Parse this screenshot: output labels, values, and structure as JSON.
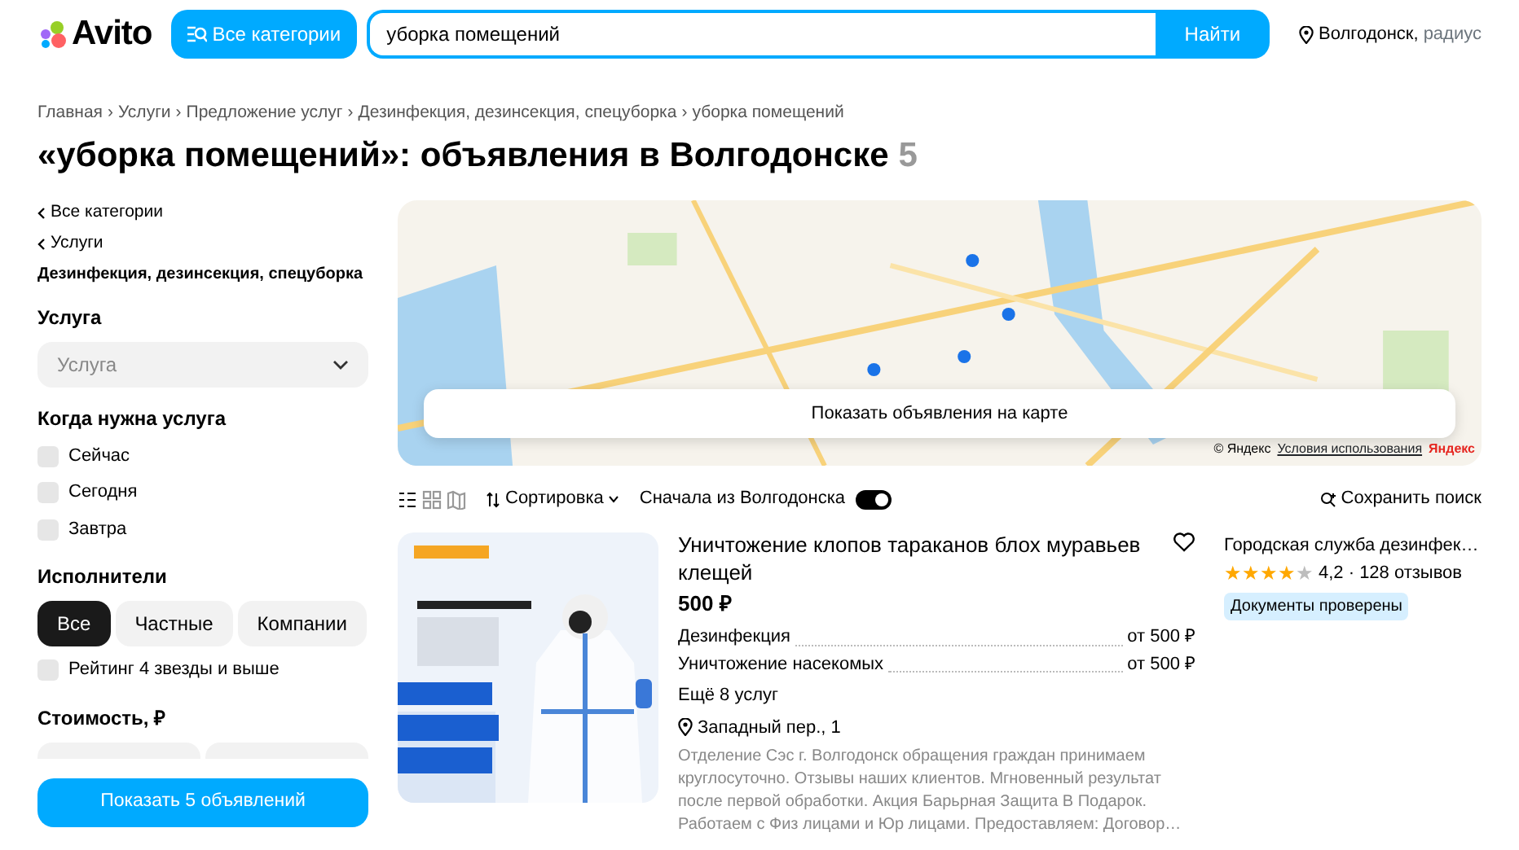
{
  "header": {
    "logo": "Avito",
    "categories_button": "Все категории",
    "search": {
      "value": "уборка помещений"
    },
    "search_button": "Найти",
    "location": "Волгодонск,",
    "radius": "радиус"
  },
  "breadcrumb_separator": "›",
  "breadcrumbs": [
    "Главная",
    "Услуги",
    "Предложение услуг",
    "Дезинфекция, дезинсекция, спецуборка",
    "уборка помещений"
  ],
  "page_title": "«уборка помещений»: объявления в Волгодонске",
  "result_count": "5",
  "sidebar": {
    "back_links": [
      "Все категории",
      "Услуги"
    ],
    "current_category": "Дезинфекция, дезинсекция, спецуборка",
    "service": {
      "title": "Услуга",
      "placeholder": "Услуга"
    },
    "when": {
      "title": "Когда нужна услуга",
      "options": [
        {
          "label": "Сейчас",
          "checked": false
        },
        {
          "label": "Сегодня",
          "checked": false
        },
        {
          "label": "Завтра",
          "checked": false
        }
      ]
    },
    "performers": {
      "title": "Исполнители",
      "segments": [
        {
          "label": "Все",
          "selected": true
        },
        {
          "label": "Частные",
          "selected": false
        },
        {
          "label": "Компании",
          "selected": false
        }
      ]
    },
    "rating_filter": {
      "label": "Рейтинг 4 звезды и выше",
      "checked": false
    },
    "price": {
      "title": "Стоимость, ₽"
    },
    "show_button": "Показать 5 объявлений"
  },
  "map": {
    "kind": "picture",
    "button": "Показать объявления на карте",
    "copyright": "© Яндекс",
    "terms_link": "Условия использования",
    "brand": "Яндекс"
  },
  "toolbar": {
    "views": [
      {
        "kind": "list",
        "selected": true
      },
      {
        "kind": "grid",
        "selected": false
      },
      {
        "kind": "map",
        "selected": false
      }
    ],
    "sort": "Сортировка",
    "toggle": {
      "label": "Сначала из Волгодонска",
      "on": true
    },
    "save_search": "Сохранить поиск"
  },
  "listings": [
    {
      "image": {
        "kind": "picture"
      },
      "title": "Уничтожение клопов тараканов блох муравьев клещей",
      "price": "500 ₽",
      "favorite": false,
      "services": [
        {
          "name": "Дезинфекция",
          "price": "от 500 ₽"
        },
        {
          "name": "Уничтожение насекомых",
          "price": "от 500 ₽"
        }
      ],
      "more": "Ещё 8 услуг",
      "address": "Западный пер., 1",
      "description": "Отделение Сэс г. Волгодонск обращения граждан принимаем круглосуточно. Отзывы наших клиентов. Мгновенный результат после первой обработки. Акция Барьрная Защита В Подарок. Работаем с Физ лицами и Юр лицами. Предоставляем: Договор…",
      "seller": {
        "name": "Городская служба дезинфек…",
        "stars": 4,
        "rating": "4,2 · 128 отзывов",
        "badge": "Документы проверены"
      }
    }
  ]
}
